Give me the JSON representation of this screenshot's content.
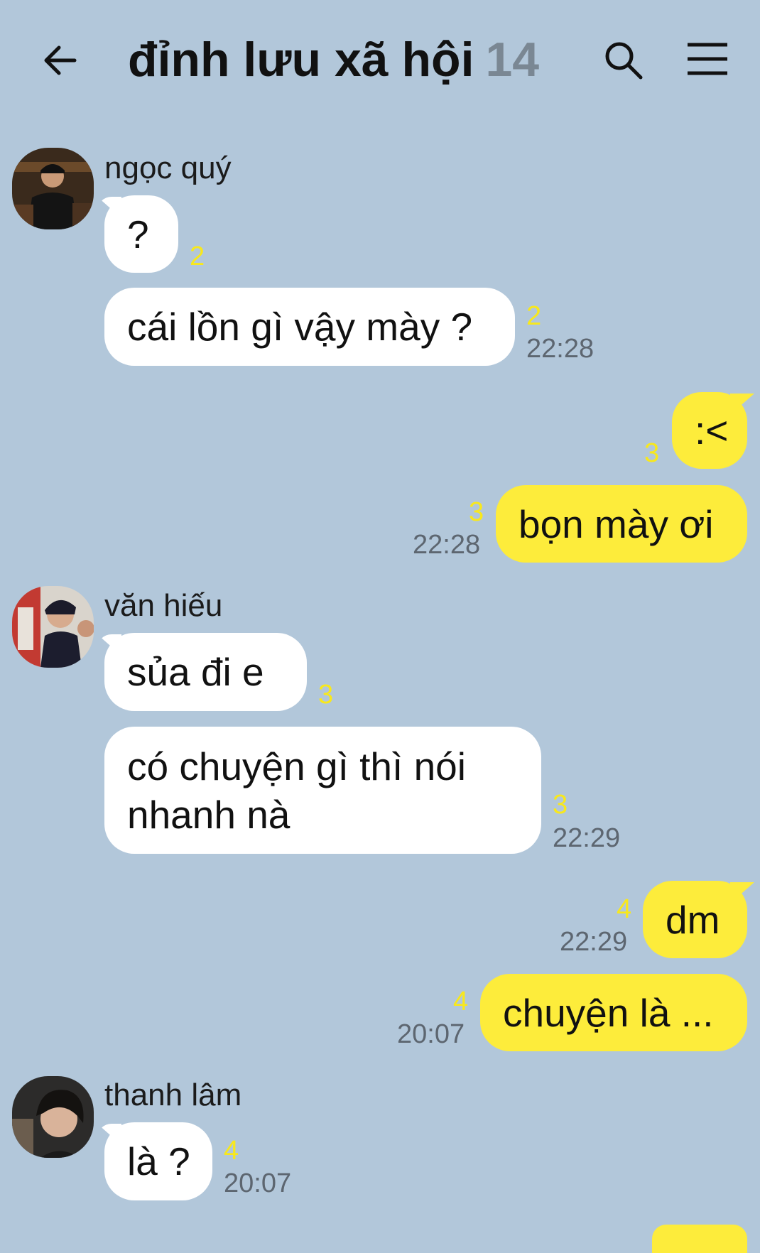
{
  "header": {
    "title": "đỉnh lưu xã hội",
    "member_count": "14"
  },
  "colors": {
    "background": "#b2c7da",
    "bubble_in": "#ffffff",
    "bubble_out": "#fdec3b",
    "unread": "#f8e81c",
    "time": "#5d6670"
  },
  "messages": [
    {
      "sender": "ngọc quý",
      "text": "?",
      "unread": "2",
      "direction": "in"
    },
    {
      "text": "cái lồn gì vậy mày ?",
      "unread": "2",
      "time": "22:28",
      "direction": "in"
    },
    {
      "text": ":<",
      "unread": "3",
      "direction": "out"
    },
    {
      "text": "bọn mày ơi",
      "unread": "3",
      "time": "22:28",
      "direction": "out"
    },
    {
      "sender": "văn hiếu",
      "text": "sủa đi e",
      "unread": "3",
      "direction": "in"
    },
    {
      "text": "có chuyện gì thì nói nhanh nà",
      "unread": "3",
      "time": "22:29",
      "direction": "in"
    },
    {
      "text": "dm",
      "unread": "4",
      "time": "22:29",
      "direction": "out"
    },
    {
      "text": "chuyện là ...",
      "unread": "4",
      "time": "20:07",
      "direction": "out"
    },
    {
      "sender": "thanh lâm",
      "text": "là ?",
      "unread": "4",
      "time": "20:07",
      "direction": "in"
    }
  ],
  "icons": {
    "back": "arrow-left-icon",
    "search": "search-icon",
    "menu": "hamburger-menu-icon"
  }
}
